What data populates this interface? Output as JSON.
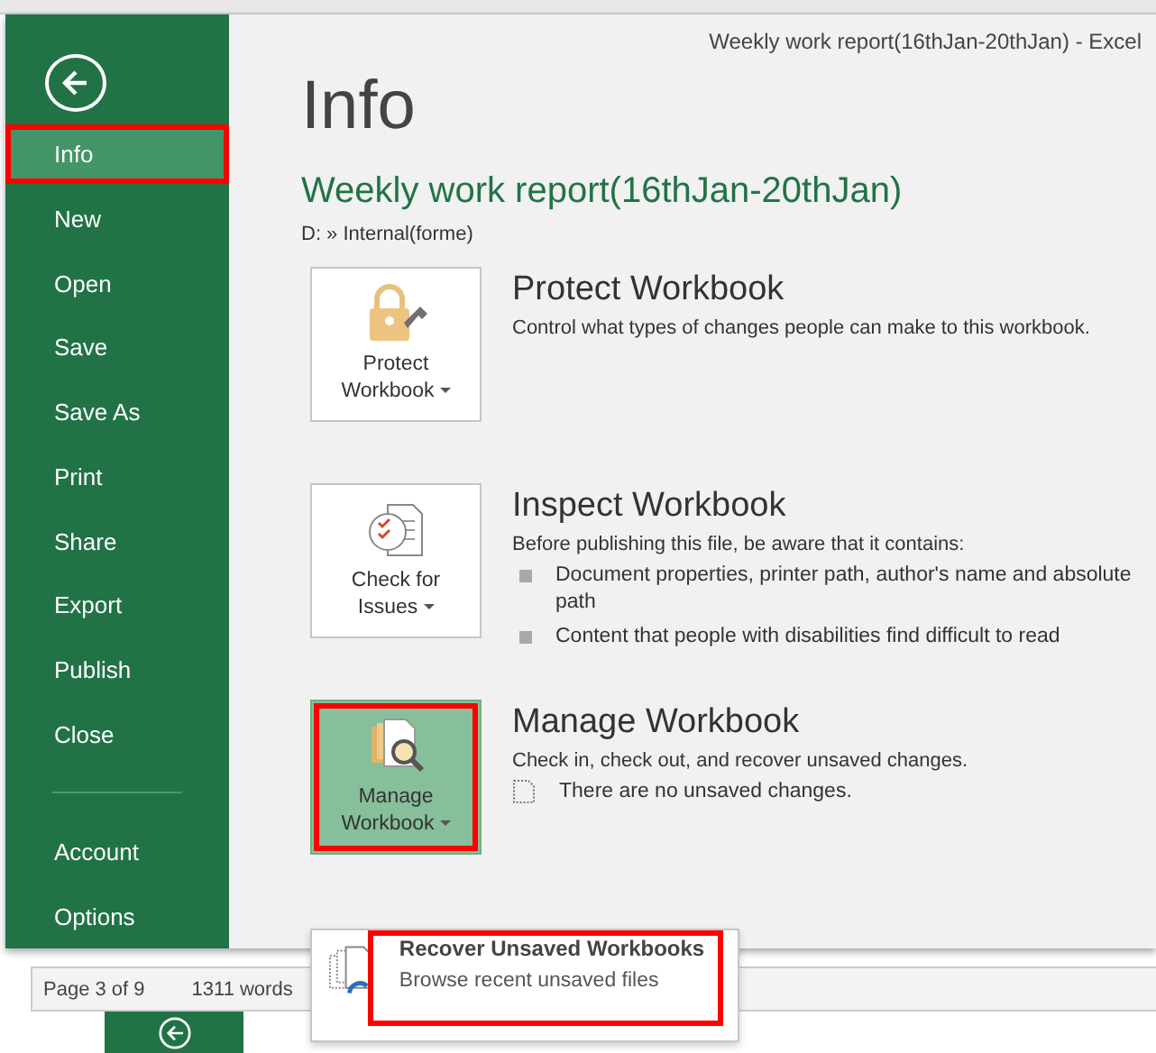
{
  "window": {
    "title": "Weekly work report(16thJan-20thJan) - Excel"
  },
  "sidebar": {
    "items": [
      {
        "label": "Info",
        "selected": true,
        "annotated": true
      },
      {
        "label": "New",
        "selected": false,
        "annotated": false
      },
      {
        "label": "Open",
        "selected": false,
        "annotated": false
      },
      {
        "label": "Save",
        "selected": false,
        "annotated": false
      },
      {
        "label": "Save As",
        "selected": false,
        "annotated": false
      },
      {
        "label": "Print",
        "selected": false,
        "annotated": false
      },
      {
        "label": "Share",
        "selected": false,
        "annotated": false
      },
      {
        "label": "Export",
        "selected": false,
        "annotated": false
      },
      {
        "label": "Publish",
        "selected": false,
        "annotated": false
      },
      {
        "label": "Close",
        "selected": false,
        "annotated": false
      }
    ],
    "footer_items": [
      {
        "label": "Account",
        "selected": false,
        "annotated": false
      },
      {
        "label": "Options",
        "selected": false,
        "annotated": false
      }
    ]
  },
  "page": {
    "heading": "Info",
    "file_name": "Weekly work report(16thJan-20thJan)",
    "path": "D: » Internal(forme)"
  },
  "sections": [
    {
      "button_lines": [
        "Protect",
        "Workbook"
      ],
      "selected": false,
      "annotated": false,
      "title": "Protect Workbook",
      "description": "Control what types of changes people can make to this workbook."
    },
    {
      "button_lines": [
        "Check for",
        "Issues"
      ],
      "selected": false,
      "annotated": false,
      "title": "Inspect Workbook",
      "description": "Before publishing this file, be aware that it contains:",
      "bullets": [
        "Document properties, printer path, author's name and absolute path",
        "Content that people with disabilities find difficult to read"
      ]
    },
    {
      "button_lines": [
        "Manage",
        "Workbook"
      ],
      "selected": true,
      "annotated": true,
      "title": "Manage Workbook",
      "description": "Check in, check out, and recover unsaved changes.",
      "notes": [
        "There are no unsaved changes."
      ]
    }
  ],
  "popup": {
    "title": "Recover Unsaved Workbooks",
    "subtitle": "Browse recent unsaved files",
    "annotated": true
  },
  "status_bar": {
    "items": [
      "Page 3 of 9",
      "1311 words"
    ]
  }
}
